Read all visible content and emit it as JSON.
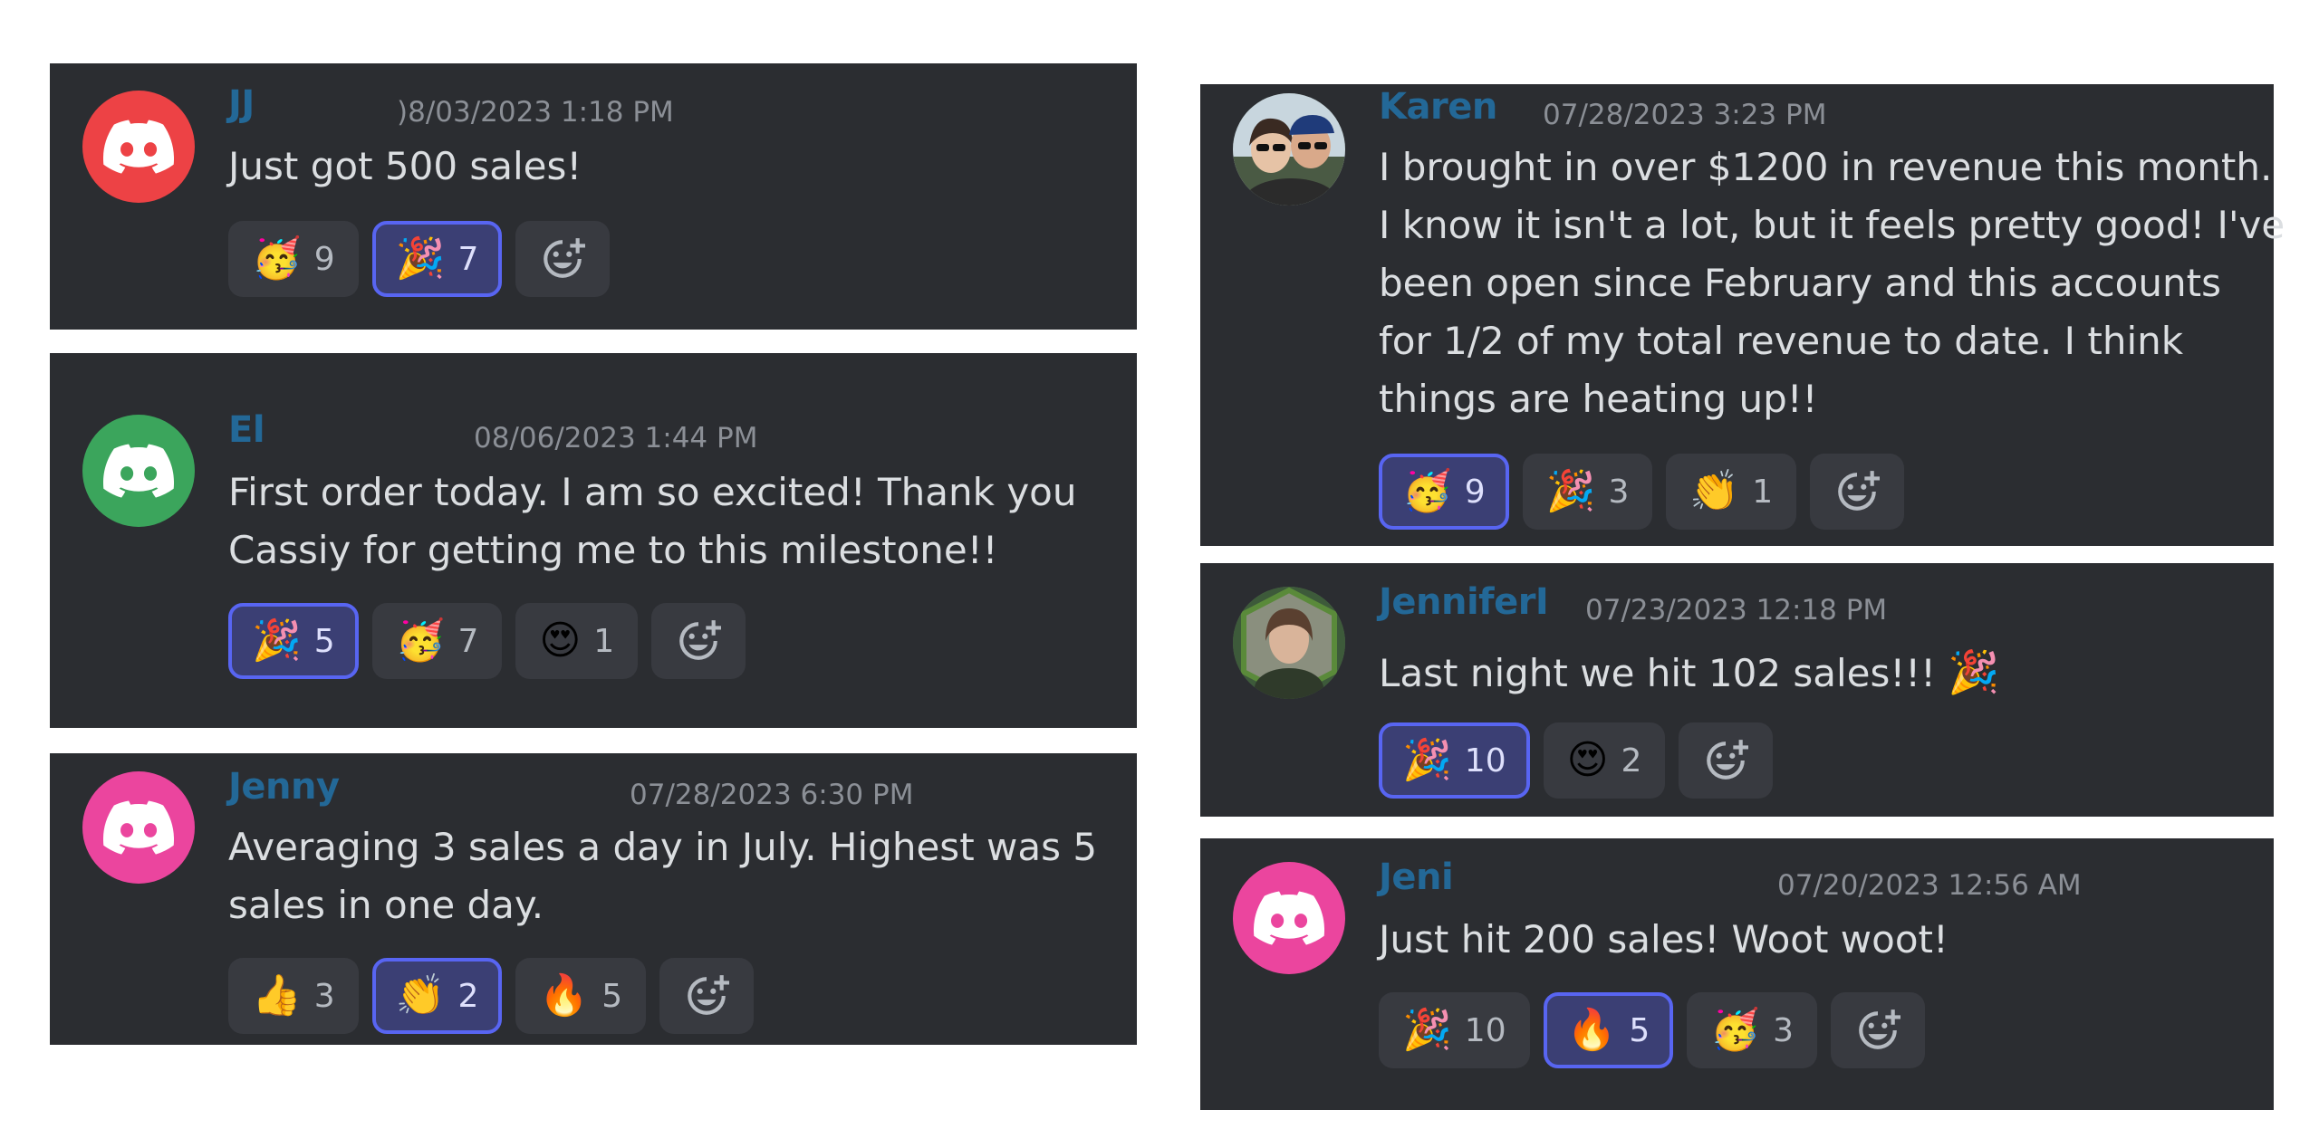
{
  "left": [
    {
      "name": "JJ",
      "timestamp": ")8/03/2023 1:18 PM",
      "avatar_color": "#ed4245",
      "lines": [
        "Just got 500 sales!"
      ],
      "reactions": [
        {
          "emoji": "🥳",
          "count": "9",
          "active": false
        },
        {
          "emoji": "🎉",
          "count": "7",
          "active": true
        }
      ]
    },
    {
      "name": "El",
      "timestamp": "08/06/2023 1:44 PM",
      "avatar_color": "#3ba55c",
      "lines": [
        "First order today. I am so excited! Thank you",
        "Cassiy for getting me to this milestone!!"
      ],
      "reactions": [
        {
          "emoji": "🎉",
          "count": "5",
          "active": true
        },
        {
          "emoji": "🥳",
          "count": "7",
          "active": false
        },
        {
          "emoji": "😍",
          "count": "1",
          "active": false
        }
      ]
    },
    {
      "name": "Jenny",
      "timestamp": "07/28/2023 6:30 PM",
      "avatar_color": "#eb459e",
      "lines": [
        "Averaging 3 sales a day in July. Highest was 5",
        "sales in one day."
      ],
      "reactions": [
        {
          "emoji": "👍",
          "count": "3",
          "active": false
        },
        {
          "emoji": "👏",
          "count": "2",
          "active": true
        },
        {
          "emoji": "🔥",
          "count": "5",
          "active": false
        }
      ]
    }
  ],
  "right": [
    {
      "name": "Karen",
      "timestamp": "07/28/2023 3:23 PM",
      "avatar_kind": "photo",
      "lines": [
        "I brought in over $1200 in revenue this month.",
        "I know it isn't a lot, but it feels pretty good! I've",
        "been open since February and this accounts",
        "for 1/2 of my total revenue to date. I think",
        "things are heating up!!"
      ],
      "reactions": [
        {
          "emoji": "🥳",
          "count": "9",
          "active": true
        },
        {
          "emoji": "🎉",
          "count": "3",
          "active": false
        },
        {
          "emoji": "👏",
          "count": "1",
          "active": false
        }
      ]
    },
    {
      "name": "JenniferI",
      "timestamp": "07/23/2023 12:18 PM",
      "avatar_kind": "photo",
      "lines": [
        "Last night we hit 102  sales!!!"
      ],
      "inline_emoji": "🎉",
      "reactions": [
        {
          "emoji": "🎉",
          "count": "10",
          "active": true
        },
        {
          "emoji": "😍",
          "count": "2",
          "active": false
        }
      ]
    },
    {
      "name": "Jeni",
      "timestamp": "07/20/2023 12:56 AM",
      "avatar_color": "#eb459e",
      "lines": [
        "Just hit 200 sales! Woot woot!"
      ],
      "reactions": [
        {
          "emoji": "🎉",
          "count": "10",
          "active": false
        },
        {
          "emoji": "🔥",
          "count": "5",
          "active": true
        },
        {
          "emoji": "🥳",
          "count": "3",
          "active": false
        }
      ]
    }
  ],
  "add_reaction_icon": "add-reaction-icon",
  "default_avatar_icon": "discord-logo-icon"
}
